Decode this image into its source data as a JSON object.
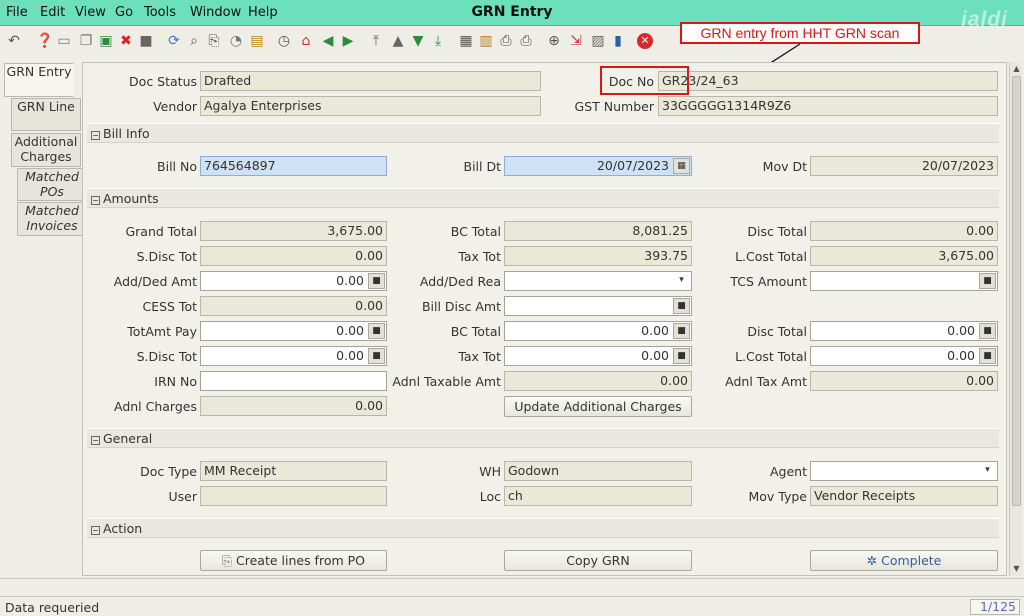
{
  "window": {
    "title": "GRN Entry",
    "logo": "jaldi"
  },
  "menu": [
    {
      "label": "File"
    },
    {
      "label": "Edit"
    },
    {
      "label": "View"
    },
    {
      "label": "Go"
    },
    {
      "label": "Tools"
    },
    {
      "label": "Window"
    },
    {
      "label": "Help"
    }
  ],
  "annotation": {
    "text": "GRN entry from HHT GRN scan"
  },
  "side_tabs": [
    {
      "label": "GRN Entry",
      "active": true
    },
    {
      "label": "GRN Line"
    },
    {
      "label": "Additional Charges"
    },
    {
      "label": "Matched POs"
    },
    {
      "label": "Matched Invoices"
    }
  ],
  "header": {
    "doc_status_label": "Doc Status",
    "doc_status": "Drafted",
    "doc_no_label": "Doc No",
    "doc_no": "GR23/24_63",
    "vendor_label": "Vendor",
    "vendor": "Agalya Enterprises",
    "gst_label": "GST Number",
    "gst": "33GGGGG1314R9Z6"
  },
  "bill_info": {
    "section": "Bill Info",
    "bill_no_label": "Bill No",
    "bill_no": "764564897",
    "bill_dt_label": "Bill Dt",
    "bill_dt": "20/07/2023",
    "mov_dt_label": "Mov Dt",
    "mov_dt": "20/07/2023"
  },
  "amounts": {
    "section": "Amounts",
    "grand_total_label": "Grand Total",
    "grand_total": "3,675.00",
    "bc_total_label": "BC Total",
    "bc_total": "8,081.25",
    "disc_total_label": "Disc Total",
    "disc_total": "0.00",
    "sdisc_tot_label": "S.Disc Tot",
    "sdisc_tot": "0.00",
    "tax_tot_label": "Tax Tot",
    "tax_tot": "393.75",
    "lcost_total_label": "L.Cost Total",
    "lcost_total": "3,675.00",
    "add_ded_amt_label": "Add/Ded Amt",
    "add_ded_amt": "0.00",
    "add_ded_rea_label": "Add/Ded Rea",
    "add_ded_rea": "",
    "tcs_amount_label": "TCS Amount",
    "tcs_amount": "",
    "cess_tot_label": "CESS Tot",
    "cess_tot": "0.00",
    "bill_disc_amt_label": "Bill Disc Amt",
    "bill_disc_amt": "",
    "totamt_pay_label": "TotAmt Pay",
    "totamt_pay": "0.00",
    "bc_total2_label": "BC Total",
    "bc_total2": "0.00",
    "disc_total2_label": "Disc Total",
    "disc_total2": "0.00",
    "sdisc_tot2_label": "S.Disc Tot",
    "sdisc_tot2": "0.00",
    "tax_tot2_label": "Tax Tot",
    "tax_tot2": "0.00",
    "lcost_total2_label": "L.Cost Total",
    "lcost_total2": "0.00",
    "irn_no_label": "IRN No",
    "irn_no": "",
    "adnl_taxable_label": "Adnl Taxable Amt",
    "adnl_taxable": "0.00",
    "adnl_tax_label": "Adnl Tax Amt",
    "adnl_tax": "0.00",
    "adnl_charges_label": "Adnl Charges",
    "adnl_charges": "0.00",
    "update_btn": "Update Additional Charges"
  },
  "general": {
    "section": "General",
    "doc_type_label": "Doc Type",
    "doc_type": "MM Receipt",
    "wh_label": "WH",
    "wh": "Godown",
    "agent_label": "Agent",
    "agent": "",
    "user_label": "User",
    "user": "",
    "loc_label": "Loc",
    "loc": "ch",
    "mov_type_label": "Mov Type",
    "mov_type": "Vendor Receipts"
  },
  "action": {
    "section": "Action",
    "create_lines_btn": "Create lines from PO",
    "copy_grn_btn": "Copy GRN",
    "complete_btn": "Complete"
  },
  "status": {
    "message": "Data requeried",
    "record": "1/125"
  },
  "colors": {
    "title_bar": "#6ce0bb",
    "callout": "#d81818",
    "readonly_field": "#e9e8d9",
    "focused_field": "#cfe1f4"
  }
}
